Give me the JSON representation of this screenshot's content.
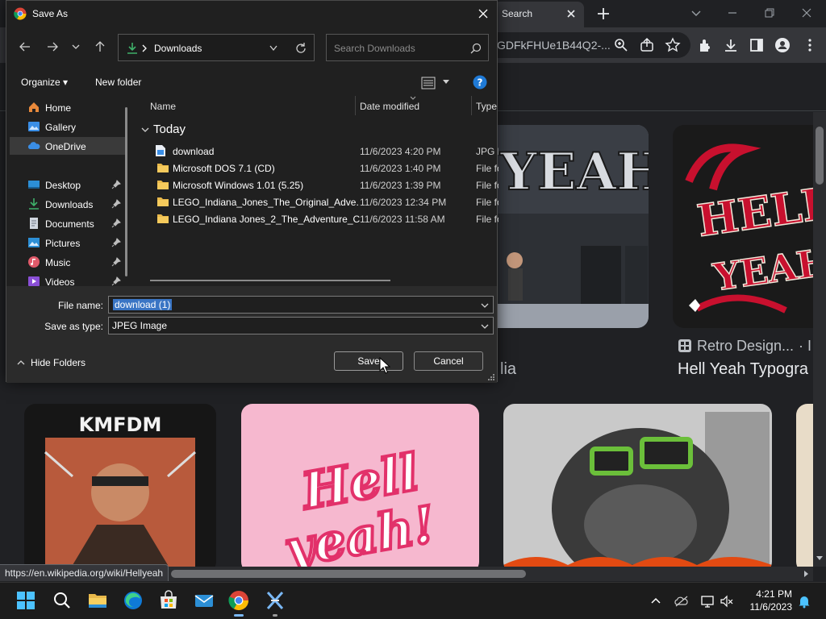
{
  "browser": {
    "tab_title": "Search",
    "omnibox_url": "GDFkFHUe1B44Q2-...",
    "status_url": "https://en.wikipedia.org/wiki/Hellyeah",
    "image_results": {
      "card1_caption_partial": "lia",
      "card2_source": "Retro Design...",
      "card2_source_suffix": "· I",
      "card2_title": "Hell Yeah Typogra",
      "card3_label": "KMFDM"
    }
  },
  "dialog": {
    "title": "Save As",
    "address_label": "Downloads",
    "search_placeholder": "Search Downloads",
    "organize_label": "Organize",
    "new_folder_label": "New folder",
    "nav_items": [
      {
        "label": "Home",
        "icon": "home-icon"
      },
      {
        "label": "Gallery",
        "icon": "gallery-icon"
      },
      {
        "label": "OneDrive",
        "icon": "onedrive-icon"
      },
      {
        "label": "Desktop",
        "icon": "desktop-icon"
      },
      {
        "label": "Downloads",
        "icon": "download-icon"
      },
      {
        "label": "Documents",
        "icon": "documents-icon"
      },
      {
        "label": "Pictures",
        "icon": "pictures-icon"
      },
      {
        "label": "Music",
        "icon": "music-icon"
      },
      {
        "label": "Videos",
        "icon": "videos-icon"
      }
    ],
    "columns": {
      "name": "Name",
      "date": "Date modified",
      "type": "Type"
    },
    "group_label": "Today",
    "files": [
      {
        "name": "download",
        "date": "11/6/2023 4:20 PM",
        "type": "JPG F",
        "icon": "image-file-icon"
      },
      {
        "name": "Microsoft DOS 7.1 (CD)",
        "date": "11/6/2023 1:40 PM",
        "type": "File fo",
        "icon": "folder-icon"
      },
      {
        "name": "Microsoft Windows 1.01 (5.25)",
        "date": "11/6/2023 1:39 PM",
        "type": "File fo",
        "icon": "folder-icon"
      },
      {
        "name": "LEGO_Indiana_Jones_The_Original_Adve...",
        "date": "11/6/2023 12:34 PM",
        "type": "File fo",
        "icon": "folder-icon"
      },
      {
        "name": "LEGO_Indiana Jones_2_The_Adventure_C...",
        "date": "11/6/2023 11:58 AM",
        "type": "File fo",
        "icon": "folder-icon"
      }
    ],
    "file_name_label": "File name:",
    "file_name_value": "download (1)",
    "save_type_label": "Save as type:",
    "save_type_value": "JPEG Image",
    "hide_folders_label": "Hide Folders",
    "save_label": "Save",
    "cancel_label": "Cancel"
  },
  "taskbar": {
    "time": "4:21 PM",
    "date": "11/6/2023"
  },
  "colors": {
    "dialog_bg": "#202020",
    "selection": "#3a75c4",
    "folder": "#e8b84a",
    "accent": "#7ab8f5"
  }
}
